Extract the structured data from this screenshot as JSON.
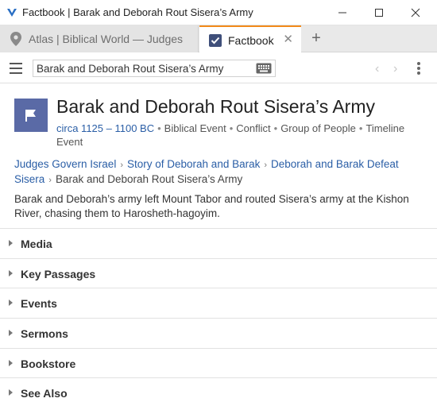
{
  "window": {
    "title": "Factbook | Barak and Deborah Rout Sisera’s Army"
  },
  "tabs": [
    {
      "label": "Atlas | Biblical World — Judges",
      "icon": "map-pin-icon"
    },
    {
      "label": "Factbook",
      "icon": "factbook-icon",
      "close": "✕"
    }
  ],
  "tab_add_label": "+",
  "toolbar": {
    "search_value": "Barak and Deborah Rout Sisera’s Army",
    "back_label": "‹",
    "forward_label": "›"
  },
  "article": {
    "title": "Barak and Deborah Rout Sisera’s Army",
    "date_link": "circa 1125 – 1100 BC",
    "tags": [
      "Biblical Event",
      "Conflict",
      "Group of People",
      "Timeline Event"
    ],
    "breadcrumb": [
      "Judges Govern Israel",
      "Story of Deborah and Barak",
      "Deborah and Barak Defeat Sisera"
    ],
    "breadcrumb_current": "Barak and Deborah Rout Sisera’s Army",
    "description": "Barak and Deborah’s army left Mount Tabor and routed Sisera’s army at the Kishon River, chasing them to Harosheth-hagoyim."
  },
  "sections": [
    "Media",
    "Key Passages",
    "Events",
    "Sermons",
    "Bookstore",
    "See Also"
  ],
  "colors": {
    "accent": "#f28a1a",
    "link": "#2a5ea6",
    "article_icon_bg": "#5a6aa6"
  }
}
